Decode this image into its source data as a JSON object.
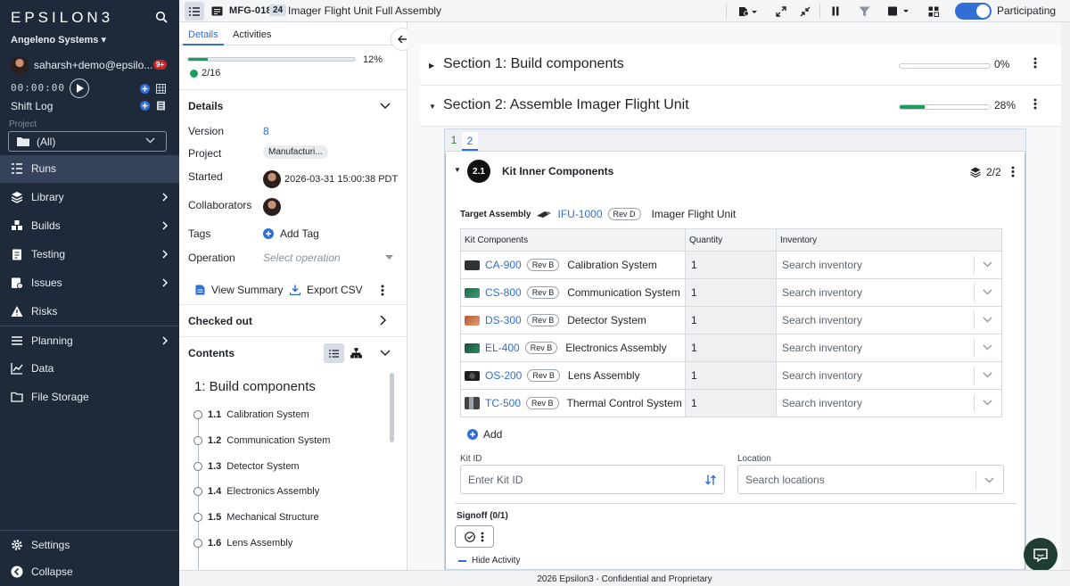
{
  "sidebar": {
    "logo": "EPSILON3",
    "org": "Angeleno Systems",
    "user": "saharsh+demo@epsilo...",
    "notif_count": "9+",
    "timer": "00:00:00",
    "shift_log": "Shift Log",
    "project_label": "Project",
    "project_value": "(All)",
    "items": [
      {
        "label": "Runs",
        "icon": "runs-icon"
      },
      {
        "label": "Library",
        "icon": "library-icon"
      },
      {
        "label": "Builds",
        "icon": "builds-icon"
      },
      {
        "label": "Testing",
        "icon": "testing-icon"
      },
      {
        "label": "Issues",
        "icon": "issues-icon"
      },
      {
        "label": "Risks",
        "icon": "risks-icon"
      },
      {
        "label": "Planning",
        "icon": "planning-icon"
      },
      {
        "label": "Data",
        "icon": "data-icon"
      },
      {
        "label": "File Storage",
        "icon": "folder-icon"
      }
    ],
    "settings": "Settings",
    "collapse": "Collapse"
  },
  "topbar": {
    "run_id": "MFG-018",
    "run_num": "24",
    "run_title": "Imager Flight Unit Full Assembly",
    "participating": "Participating"
  },
  "panel": {
    "tabs": [
      "Details",
      "Activities"
    ],
    "progress_pct": "12%",
    "progress_value": 0.12,
    "progress_steps": "2/16",
    "details_header": "Details",
    "version_label": "Version",
    "version_value": "8",
    "project_label": "Project",
    "project_value": "Manufacturi...",
    "started_label": "Started",
    "started_value": "2026-03-31 15:00:38 PDT",
    "collaborators_label": "Collaborators",
    "tags_label": "Tags",
    "add_tag": "Add Tag",
    "operation_label": "Operation",
    "operation_placeholder": "Select operation",
    "view_summary": "View Summary",
    "export_csv": "Export CSV",
    "checked_out": "Checked out",
    "contents": "Contents",
    "contents_title": "1: Build components",
    "toc": [
      {
        "num": "1.1",
        "label": "Calibration System"
      },
      {
        "num": "1.2",
        "label": "Communication System"
      },
      {
        "num": "1.3",
        "label": "Detector System"
      },
      {
        "num": "1.4",
        "label": "Electronics Assembly"
      },
      {
        "num": "1.5",
        "label": "Mechanical Structure"
      },
      {
        "num": "1.6",
        "label": "Lens Assembly"
      }
    ]
  },
  "main": {
    "section1": {
      "title": "Section 1: Build components",
      "pct": "0%",
      "progress": 0
    },
    "section2": {
      "title": "Section 2: Assemble Imager Flight Unit",
      "pct": "28%",
      "progress": 0.28
    },
    "step_tabs": [
      "1",
      "2"
    ],
    "step": {
      "num": "2.1",
      "title": "Kit Inner Components",
      "count": "2/2",
      "target_label": "Target Assembly",
      "target_pn": "IFU-1000",
      "target_rev": "Rev D",
      "target_name": "Imager Flight Unit",
      "columns": [
        "Kit Components",
        "Quantity",
        "Inventory"
      ],
      "rows": [
        {
          "pn": "CA-900",
          "rev": "Rev B",
          "name": "Calibration System",
          "qty": "1",
          "inv": "Search inventory"
        },
        {
          "pn": "CS-800",
          "rev": "Rev B",
          "name": "Communication System",
          "qty": "1",
          "inv": "Search inventory"
        },
        {
          "pn": "DS-300",
          "rev": "Rev B",
          "name": "Detector System",
          "qty": "1",
          "inv": "Search inventory"
        },
        {
          "pn": "EL-400",
          "rev": "Rev B",
          "name": "Electronics Assembly",
          "qty": "1",
          "inv": "Search inventory"
        },
        {
          "pn": "OS-200",
          "rev": "Rev B",
          "name": "Lens Assembly",
          "qty": "1",
          "inv": "Search inventory"
        },
        {
          "pn": "TC-500",
          "rev": "Rev B",
          "name": "Thermal Control System",
          "qty": "1",
          "inv": "Search inventory"
        }
      ],
      "add": "Add",
      "kit_id_label": "Kit ID",
      "kit_id_placeholder": "Enter Kit ID",
      "location_label": "Location",
      "location_placeholder": "Search locations",
      "signoff": "Signoff (0/1)",
      "hide_activity": "Hide Activity"
    }
  },
  "footer": "2026 Epsilon3 - Confidential and Proprietary",
  "colors": {
    "sidebar": "#1e2a3a",
    "accent": "#2f6fd6",
    "progress": "#1aa05b"
  }
}
